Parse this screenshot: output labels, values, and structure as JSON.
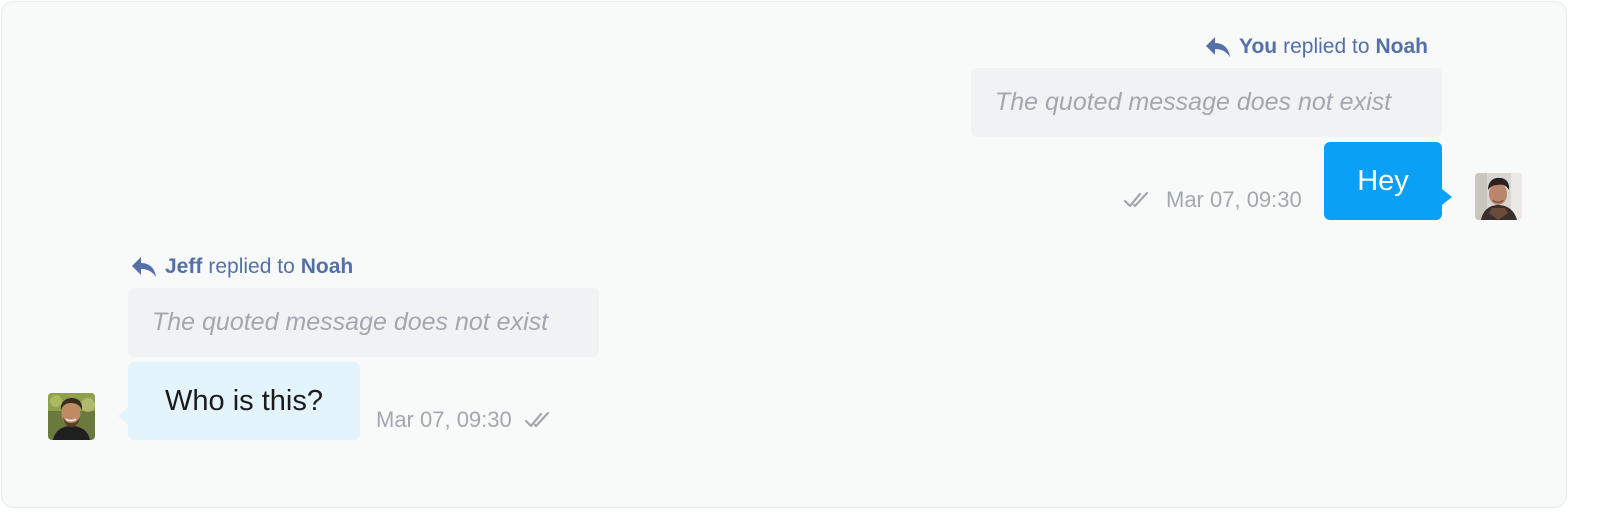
{
  "messages": [
    {
      "direction": "outgoing",
      "reply": {
        "from": "You",
        "mid_text": "replied to",
        "to": "Noah"
      },
      "quote_text": "The quoted message does not exist",
      "text": "Hey",
      "timestamp": "Mar 07, 09:30",
      "status_icon": "double-check-icon"
    },
    {
      "direction": "incoming",
      "reply": {
        "from": "Jeff",
        "mid_text": "replied to",
        "to": "Noah"
      },
      "quote_text": "The quoted message does not exist",
      "text": "Who is this?",
      "timestamp": "Mar 07, 09:30",
      "status_icon": "double-check-icon"
    }
  ],
  "colors": {
    "accent": "#5570a8",
    "outgoing_bubble": "#0aa0f6",
    "incoming_bubble": "#e4f4fd",
    "quote_bg": "#f1f2f4",
    "muted_text": "#a3a8ae",
    "panel_bg": "#f8f9f9"
  }
}
